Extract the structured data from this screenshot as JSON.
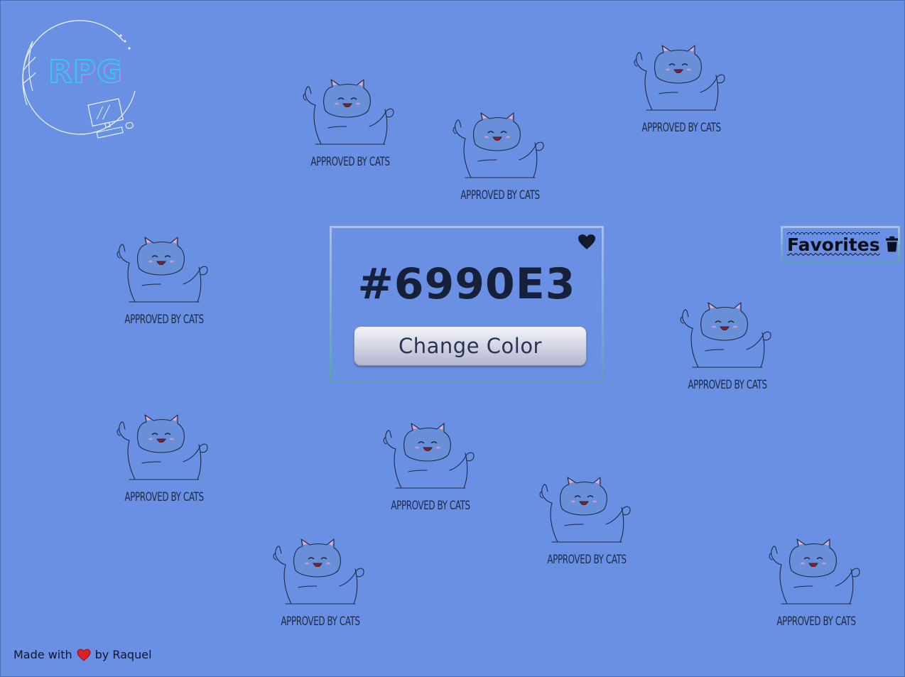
{
  "logo": {
    "text": "RPG"
  },
  "card": {
    "hex": "#6990E3",
    "button_label": "Change Color"
  },
  "favorites": {
    "label": "Favorites"
  },
  "background": {
    "color": "#6990E3",
    "cat_caption": "APPROVED BY CATS"
  },
  "footer": {
    "prefix": "Made with",
    "suffix": "by Raquel"
  },
  "colors": {
    "accent": "#6990E3",
    "text_dark": "#17203a",
    "heart": "#e02020"
  }
}
